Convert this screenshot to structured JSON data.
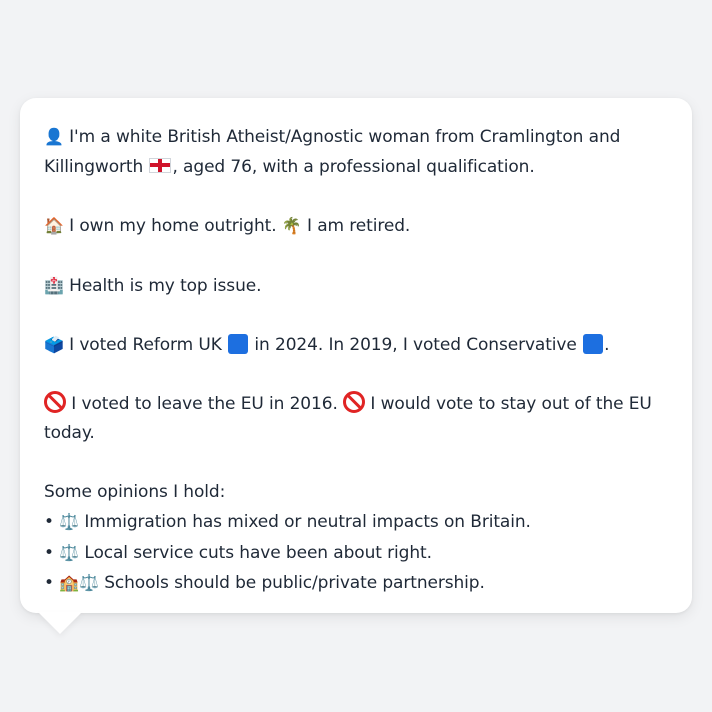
{
  "profile": {
    "line1_icon": "person-silhouette-icon",
    "line1_text_a": " I'm a white British Atheist/Agnostic woman from Cramlington and",
    "line1_text_b": "Killingworth ",
    "line1_flag": "england-flag-icon",
    "line1_text_c": ", aged 76, with a professional qualification.",
    "home_icon": "house-icon",
    "home_text": " I own my home outright. ",
    "retired_icon": "palm-tree-icon",
    "retired_text": " I am retired.",
    "health_icon": "hospital-icon",
    "health_text": " Health is my top issue.",
    "vote_icon": "ballot-box-icon",
    "vote_text_a": " I voted Reform UK ",
    "vote_text_b": " in 2024. In 2019, I voted Conservative ",
    "vote_text_c": ".",
    "eu_text_a": " I voted to leave the EU in 2016. ",
    "eu_text_b": " I would vote to stay out of the EU",
    "eu_text_c": "today.",
    "opinions_heading": "Some opinions I hold:",
    "opinions": [
      {
        "bullet": "• ",
        "icons": [
          "⚖️"
        ],
        "text": " Immigration has mixed or neutral impacts on Britain."
      },
      {
        "bullet": "• ",
        "icons": [
          "⚖️"
        ],
        "text": " Local service cuts have been about right."
      },
      {
        "bullet": "• ",
        "icons": [
          "🏫",
          "⚖️"
        ],
        "text": " Schools should be public/private partnership."
      }
    ]
  },
  "colors": {
    "background": "#f2f3f5",
    "card": "#ffffff",
    "text": "#1f2937",
    "reform_blue": "#1d6fe0",
    "no_entry_red": "#e02424"
  }
}
